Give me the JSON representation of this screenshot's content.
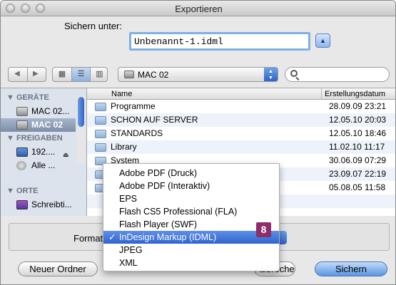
{
  "window": {
    "title": "Exportieren"
  },
  "save": {
    "label": "Sichern unter:",
    "filename": "Unbenannt-1.idml"
  },
  "toolbar": {
    "back_icon": "back-arrow-icon",
    "forward_icon": "forward-arrow-icon",
    "location": "MAC 02",
    "search_placeholder": ""
  },
  "sidebar": {
    "sections": [
      {
        "title": "GERÄTE",
        "items": [
          "MAC 02...",
          "MAC 02"
        ]
      },
      {
        "title": "FREIGABEN",
        "items": [
          "192....",
          "Alle ..."
        ]
      },
      {
        "title": "ORTE",
        "items": [
          "Schreibti..."
        ]
      }
    ]
  },
  "filelist": {
    "col_name": "Name",
    "col_date": "Erstellungsdatum",
    "rows": [
      {
        "name": "Programme",
        "date": "28.09.09 23:21"
      },
      {
        "name": "SCHON AUF SERVER",
        "date": "12.05.10 20:03"
      },
      {
        "name": "STANDARDS",
        "date": "12.05.10 18:46"
      },
      {
        "name": "Library",
        "date": "11.02.10 11:17"
      },
      {
        "name": "System",
        "date": "30.06.09 07:29"
      },
      {
        "name": "",
        "date": "23.09.07 22:19"
      },
      {
        "name": "",
        "date": "05.08.05 11:58"
      }
    ]
  },
  "format": {
    "label": "Format"
  },
  "menu": {
    "items": [
      "Adobe PDF (Druck)",
      "Adobe PDF (Interaktiv)",
      "EPS",
      "Flash CS5 Professional (FLA)",
      "Flash Player (SWF)",
      "InDesign Markup (IDML)",
      "JPEG",
      "XML"
    ],
    "selected_index": 5,
    "check": "✓"
  },
  "badge": "8",
  "buttons": {
    "new_folder": "Neuer Ordner",
    "cancel": "Abbrechen",
    "save": "Sichern"
  }
}
